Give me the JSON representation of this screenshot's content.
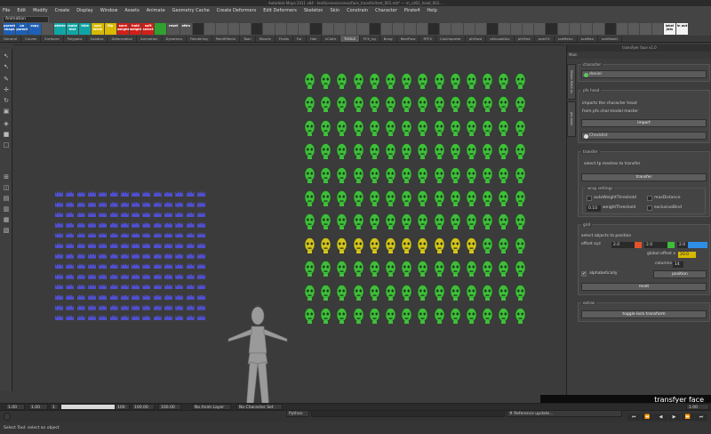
{
  "window": {
    "title": "Autodesk Maya 2011 x64 - testScenes/scenes/face_transfer/test_001.mb* --- m_cd01_head_003..."
  },
  "menu": [
    "File",
    "Edit",
    "Modify",
    "Create",
    "Display",
    "Window",
    "Assets",
    "Animate",
    "Geometry Cache",
    "Create Deformers",
    "Edit Deformers",
    "Skeleton",
    "Skin",
    "Constrain",
    "Character",
    "Pirate4",
    "Help"
  ],
  "mode_select": "Animation",
  "shelf": {
    "buttons": [
      {
        "label": "parent shape",
        "color": "#1e5fb8"
      },
      {
        "label": "un parent",
        "color": "#1e5fb8"
      },
      {
        "label": "copy",
        "color": "#1e5fb8"
      },
      {
        "label": "",
        "color": "#555555"
      },
      {
        "label": "delete",
        "color": "#12a4a4"
      },
      {
        "label": "make hist",
        "color": "#12a4a4"
      },
      {
        "label": "hide",
        "color": "#12a4a4"
      },
      {
        "label": "sym mesh",
        "color": "#d9b800"
      },
      {
        "label": "flip",
        "color": "#d9b800"
      },
      {
        "label": "save weight",
        "color": "#d0201a"
      },
      {
        "label": "hold weight",
        "color": "#d0201a"
      },
      {
        "label": "soft select",
        "color": "#d0201a"
      },
      {
        "label": "",
        "color": "#30a030"
      },
      {
        "label": "reset",
        "color": "#555555"
      },
      {
        "label": "attrs",
        "color": "#555555"
      }
    ],
    "right_buttons": [
      {
        "label": "label jnts",
        "color": "#555555"
      },
      {
        "label": "in out",
        "color": "#555555"
      }
    ]
  },
  "tabs": [
    {
      "label": "General",
      "active": false
    },
    {
      "label": "Curves",
      "active": false
    },
    {
      "label": "Surfaces",
      "active": false
    },
    {
      "label": "Polygons",
      "active": false
    },
    {
      "label": "Subdivs",
      "active": false
    },
    {
      "label": "Deformation",
      "active": false
    },
    {
      "label": "Animation",
      "active": false
    },
    {
      "label": "Dynamics",
      "active": false
    },
    {
      "label": "Rendering",
      "active": false
    },
    {
      "label": "PaintEffects",
      "active": false
    },
    {
      "label": "Toon",
      "active": false
    },
    {
      "label": "Muscle",
      "active": false
    },
    {
      "label": "Fluids",
      "active": false
    },
    {
      "label": "Fur",
      "active": false
    },
    {
      "label": "Hair",
      "active": false
    },
    {
      "label": "nCloth",
      "active": false
    },
    {
      "label": "TOOLS",
      "active": true
    },
    {
      "label": "FFX_rig",
      "active": false
    },
    {
      "label": "Bung",
      "active": false
    },
    {
      "label": "RealFlow",
      "active": false
    },
    {
      "label": "RTFX",
      "active": false
    },
    {
      "label": "Conimporter",
      "active": false
    },
    {
      "label": "pfxFace",
      "active": false
    },
    {
      "label": "pfxLookDev",
      "active": false
    },
    {
      "label": "pfxTree",
      "active": false
    },
    {
      "label": "ocerFX",
      "active": false
    },
    {
      "label": "sceMenu",
      "active": false
    },
    {
      "label": "sceMan",
      "active": false
    },
    {
      "label": "sceModel",
      "active": false
    }
  ],
  "panel": {
    "window_title": "transFyer face v1.0",
    "menu_label": "Main",
    "vertical_tabs": [
      "Model Mesh tp",
      "pfx tools"
    ],
    "character": {
      "header": "character",
      "value": "daniel"
    },
    "pfx_head": {
      "header": "pfx head",
      "line1": "imports the character head",
      "line2": "from pfx char:model master",
      "import_btn": "import",
      "dropdown": "Checklist"
    },
    "transfer": {
      "header": "transfer",
      "note": "select tp meshes to transfer",
      "btn": "transfer",
      "wrap": {
        "header": "wrap settings",
        "auto": "autoWeightThreshold",
        "max": "maxDistance",
        "exclusive": "exclusiveBind",
        "weight_value": "0.10",
        "weight_label": "weightThreshold"
      }
    },
    "grid": {
      "header": "grid",
      "note": "select objects to position",
      "offset_label": "offset xyz",
      "offset_x": "2.0",
      "offset_y": "2.0",
      "offset_z": "2.0",
      "global_label": "global offset x",
      "global_value": "20.0",
      "columns_label": "columns",
      "columns_value": "14",
      "alpha_label": "alphabetically",
      "position_btn": "position",
      "reset_btn": "reset"
    },
    "extras": {
      "header": "extras",
      "btn": "toggle lock transform"
    }
  },
  "brand": "transfyer face",
  "timeline": {
    "start": "1.00",
    "start2": "1.00",
    "current": "1",
    "end": "100",
    "range_end": "100.00",
    "end2": "100.00",
    "anim_layer": "No Anim Layer",
    "char_set": "No Character Set",
    "right_field": "1.00"
  },
  "cmd": {
    "lang": "Python",
    "output": "# Reference update..."
  },
  "help_line": "Select Tool: select an object",
  "colors": {
    "green": "#3fbe3a",
    "yellow": "#d7c21c",
    "blue": "#4f4fd0",
    "accent": "#e5522b"
  },
  "viewport": {
    "crown_grid": {
      "cols": 14,
      "rows": 13
    },
    "head_grid": {
      "cols": 14,
      "rows": 11,
      "yellow_row": 7,
      "yellow_cols": [
        0,
        1,
        2,
        3,
        4,
        5,
        6,
        7,
        8,
        9,
        10
      ]
    }
  }
}
